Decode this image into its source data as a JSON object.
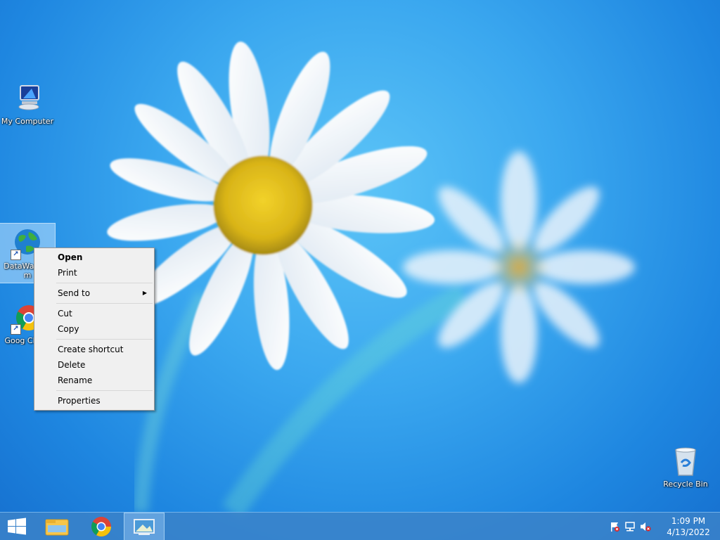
{
  "desktop": {
    "wallpaper": "daisy-flowers-blue-sky",
    "icons": [
      {
        "label": "My Computer",
        "icon": "computer-icon"
      },
      {
        "label": "DataWag...om",
        "icon": "globe-icon",
        "shortcut": true,
        "selected": true
      },
      {
        "label": "Goog Chron",
        "icon": "chrome-icon",
        "shortcut": true
      },
      {
        "label": "Recycle Bin",
        "icon": "recycle-bin-icon"
      }
    ]
  },
  "context_menu": {
    "items": {
      "open": "Open",
      "print": "Print",
      "send_to": "Send to",
      "cut": "Cut",
      "copy": "Copy",
      "create_shortcut": "Create shortcut",
      "delete": "Delete",
      "rename": "Rename",
      "properties": "Properties"
    }
  },
  "taskbar": {
    "buttons": [
      "start-icon",
      "file-explorer-icon",
      "chrome-icon",
      "desktop-app-icon"
    ],
    "tray_icons": [
      "action-center-flag-icon",
      "network-icon",
      "volume-muted-icon"
    ],
    "clock": {
      "time": "1:09 PM",
      "date": "4/13/2022"
    }
  },
  "colors": {
    "sky": "#2f97ec",
    "taskbar": "#3c82c8",
    "menu_bg": "#f0f0f0"
  }
}
